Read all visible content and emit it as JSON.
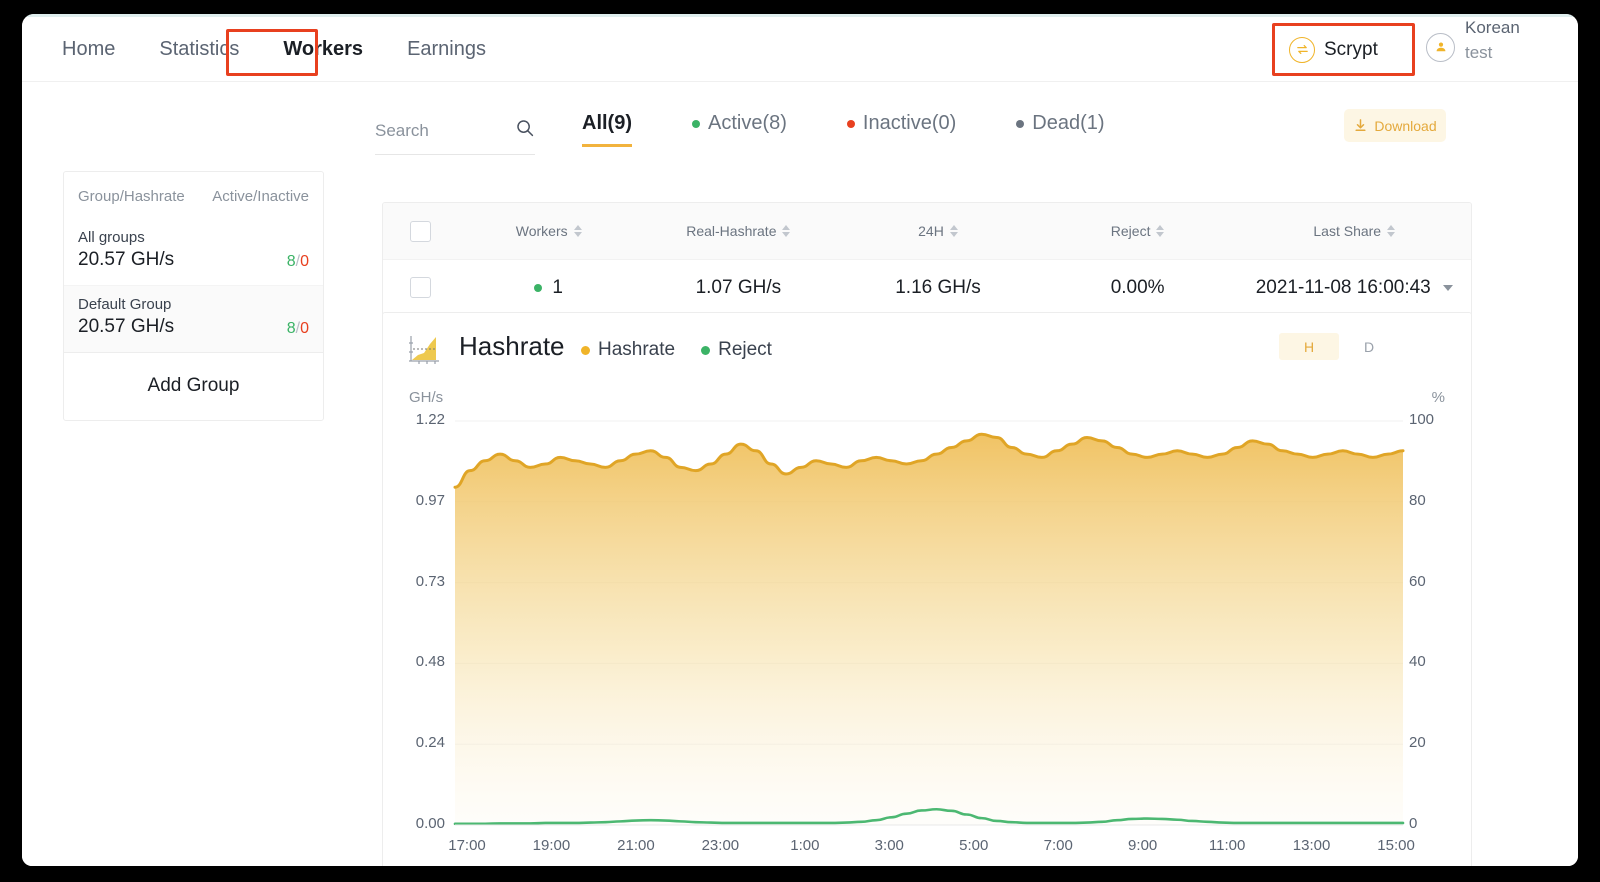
{
  "nav": {
    "links": [
      {
        "label": "Home",
        "active": false
      },
      {
        "label": "Statistics",
        "active": false
      },
      {
        "label": "Workers",
        "active": true
      },
      {
        "label": "Earnings",
        "active": false
      }
    ],
    "coin_switch": {
      "label": "Scrypt",
      "icon": "swap-icon"
    },
    "user": {
      "language": "Korean",
      "name": "test",
      "icon": "user-avatar-icon"
    }
  },
  "toolbar": {
    "search_placeholder": "Search",
    "search_value": "",
    "search_icon": "search-icon",
    "filters": [
      {
        "label": "All(9)",
        "dot": "",
        "active": true
      },
      {
        "label": "Active(8)",
        "dot": "#3bb366",
        "active": false
      },
      {
        "label": "Inactive(0)",
        "dot": "#e8401f",
        "active": false
      },
      {
        "label": "Dead(1)",
        "dot": "#6b7480",
        "active": false
      }
    ],
    "download_label": "Download",
    "download_icon": "download-icon"
  },
  "groups": {
    "header_left": "Group/Hashrate",
    "header_right": "Active/Inactive",
    "rows": [
      {
        "name": "All groups",
        "hashrate": "20.57 GH/s",
        "active": "8",
        "inactive": "0",
        "selected": false
      },
      {
        "name": "Default Group",
        "hashrate": "20.57 GH/s",
        "active": "8",
        "inactive": "0",
        "selected": true
      }
    ],
    "add_group_label": "Add Group"
  },
  "table": {
    "columns": [
      "Workers",
      "Real-Hashrate",
      "24H",
      "Reject",
      "Last Share"
    ],
    "rows": [
      {
        "status": "active",
        "worker": "1",
        "real_hashrate": "1.07 GH/s",
        "h24": "1.16 GH/s",
        "reject": "0.00%",
        "last_share": "2021-11-08 16:00:43"
      }
    ]
  },
  "chart_card": {
    "title": "Hashrate",
    "icon": "area-chart-icon",
    "legend": [
      {
        "label": "Hashrate",
        "color": "#f0b429"
      },
      {
        "label": "Reject",
        "color": "#3bb366"
      }
    ],
    "range_toggle": [
      {
        "label": "H",
        "active": true
      },
      {
        "label": "D",
        "active": false
      }
    ]
  },
  "chart_data": {
    "type": "area",
    "title": "Hashrate",
    "xlabel": "",
    "ylabel": "GH/s",
    "y2label": "%",
    "ylim": [
      0,
      1.22
    ],
    "y2lim": [
      0,
      100
    ],
    "grid": true,
    "legend_position": "top-left",
    "yticks": [
      "0.00",
      "0.24",
      "0.48",
      "0.73",
      "0.97",
      "1.22"
    ],
    "y2ticks": [
      "0",
      "20",
      "40",
      "60",
      "80",
      "100"
    ],
    "xticks": [
      "17:00",
      "19:00",
      "21:00",
      "23:00",
      "1:00",
      "3:00",
      "5:00",
      "7:00",
      "9:00",
      "11:00",
      "13:00",
      "15:00"
    ],
    "series": [
      {
        "name": "Hashrate",
        "color": "#e0a526",
        "fill": "gradient-amber",
        "axis": "left",
        "values": [
          1.02,
          1.07,
          1.1,
          1.12,
          1.1,
          1.08,
          1.09,
          1.11,
          1.1,
          1.09,
          1.08,
          1.1,
          1.12,
          1.13,
          1.11,
          1.08,
          1.07,
          1.09,
          1.12,
          1.15,
          1.13,
          1.09,
          1.06,
          1.08,
          1.1,
          1.09,
          1.08,
          1.1,
          1.11,
          1.1,
          1.09,
          1.1,
          1.12,
          1.14,
          1.16,
          1.18,
          1.17,
          1.14,
          1.12,
          1.11,
          1.13,
          1.15,
          1.17,
          1.16,
          1.14,
          1.12,
          1.11,
          1.12,
          1.13,
          1.12,
          1.11,
          1.12,
          1.14,
          1.16,
          1.15,
          1.13,
          1.12,
          1.11,
          1.12,
          1.13,
          1.12,
          1.11,
          1.12,
          1.13
        ]
      },
      {
        "name": "Reject",
        "color": "#4cb872",
        "axis": "right",
        "values": [
          0.3,
          0.3,
          0.3,
          0.4,
          0.4,
          0.4,
          0.5,
          0.5,
          0.5,
          0.6,
          0.7,
          0.9,
          1.1,
          1.2,
          1.1,
          0.9,
          0.7,
          0.6,
          0.5,
          0.5,
          0.5,
          0.5,
          0.5,
          0.5,
          0.5,
          0.5,
          0.6,
          0.8,
          1.2,
          1.9,
          2.8,
          3.6,
          3.9,
          3.5,
          2.6,
          1.7,
          1.0,
          0.7,
          0.5,
          0.5,
          0.5,
          0.5,
          0.6,
          0.8,
          1.2,
          1.5,
          1.6,
          1.5,
          1.3,
          1.0,
          0.8,
          0.6,
          0.5,
          0.5,
          0.5,
          0.5,
          0.5,
          0.5,
          0.5,
          0.5,
          0.5,
          0.5,
          0.5,
          0.5
        ]
      }
    ]
  }
}
